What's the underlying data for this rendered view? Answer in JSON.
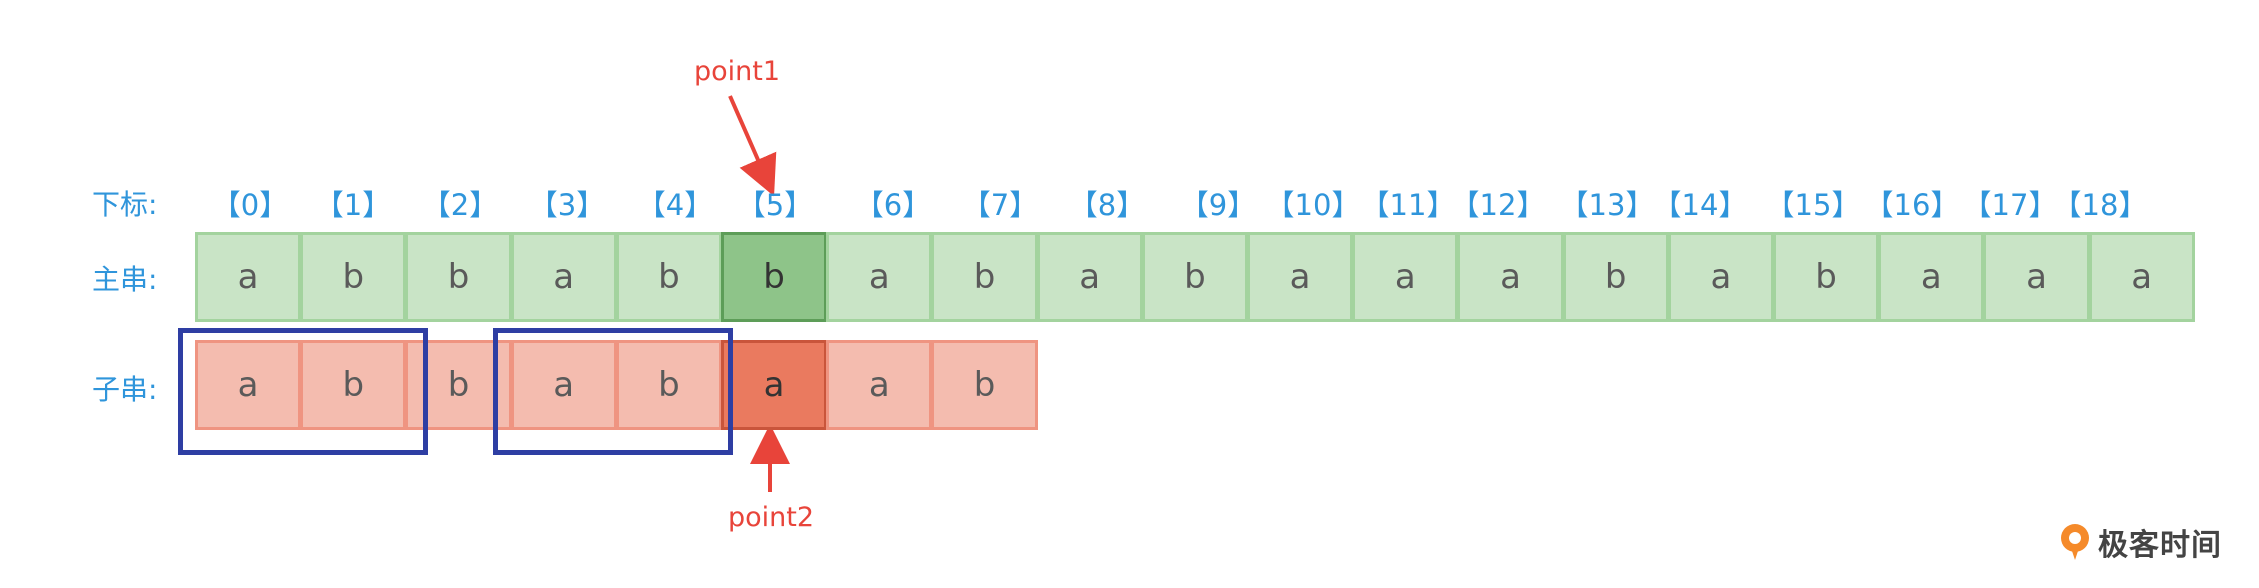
{
  "labels": {
    "index_row": "下标:",
    "main_row": "主串:",
    "sub_row": "子串:"
  },
  "indices": [
    "【0】",
    "【1】",
    "【2】",
    "【3】",
    "【4】",
    "【5】",
    "【6】",
    "【7】",
    "【8】",
    "【9】",
    "【10】",
    "【11】",
    "【12】",
    "【13】",
    "【14】",
    "【15】",
    "【16】",
    "【17】",
    "【18】"
  ],
  "main_string": [
    "a",
    "b",
    "b",
    "a",
    "b",
    "b",
    "a",
    "b",
    "a",
    "b",
    "a",
    "a",
    "a",
    "b",
    "a",
    "b",
    "a",
    "a",
    "a"
  ],
  "sub_string": [
    "a",
    "b",
    "b",
    "a",
    "b",
    "a",
    "a",
    "b"
  ],
  "highlight_index": 5,
  "pointers": {
    "point1": "point1",
    "point2": "point2"
  },
  "brand": {
    "logo_text": "极客时间"
  },
  "colors": {
    "index_text": "#2f95db",
    "main_fill": "#c9e4c6",
    "main_highlight": "#8ec489",
    "sub_fill": "#f4bcaf",
    "sub_highlight": "#ea7a5f",
    "group_box": "#2e3ea3",
    "pointer": "#e8443a"
  }
}
